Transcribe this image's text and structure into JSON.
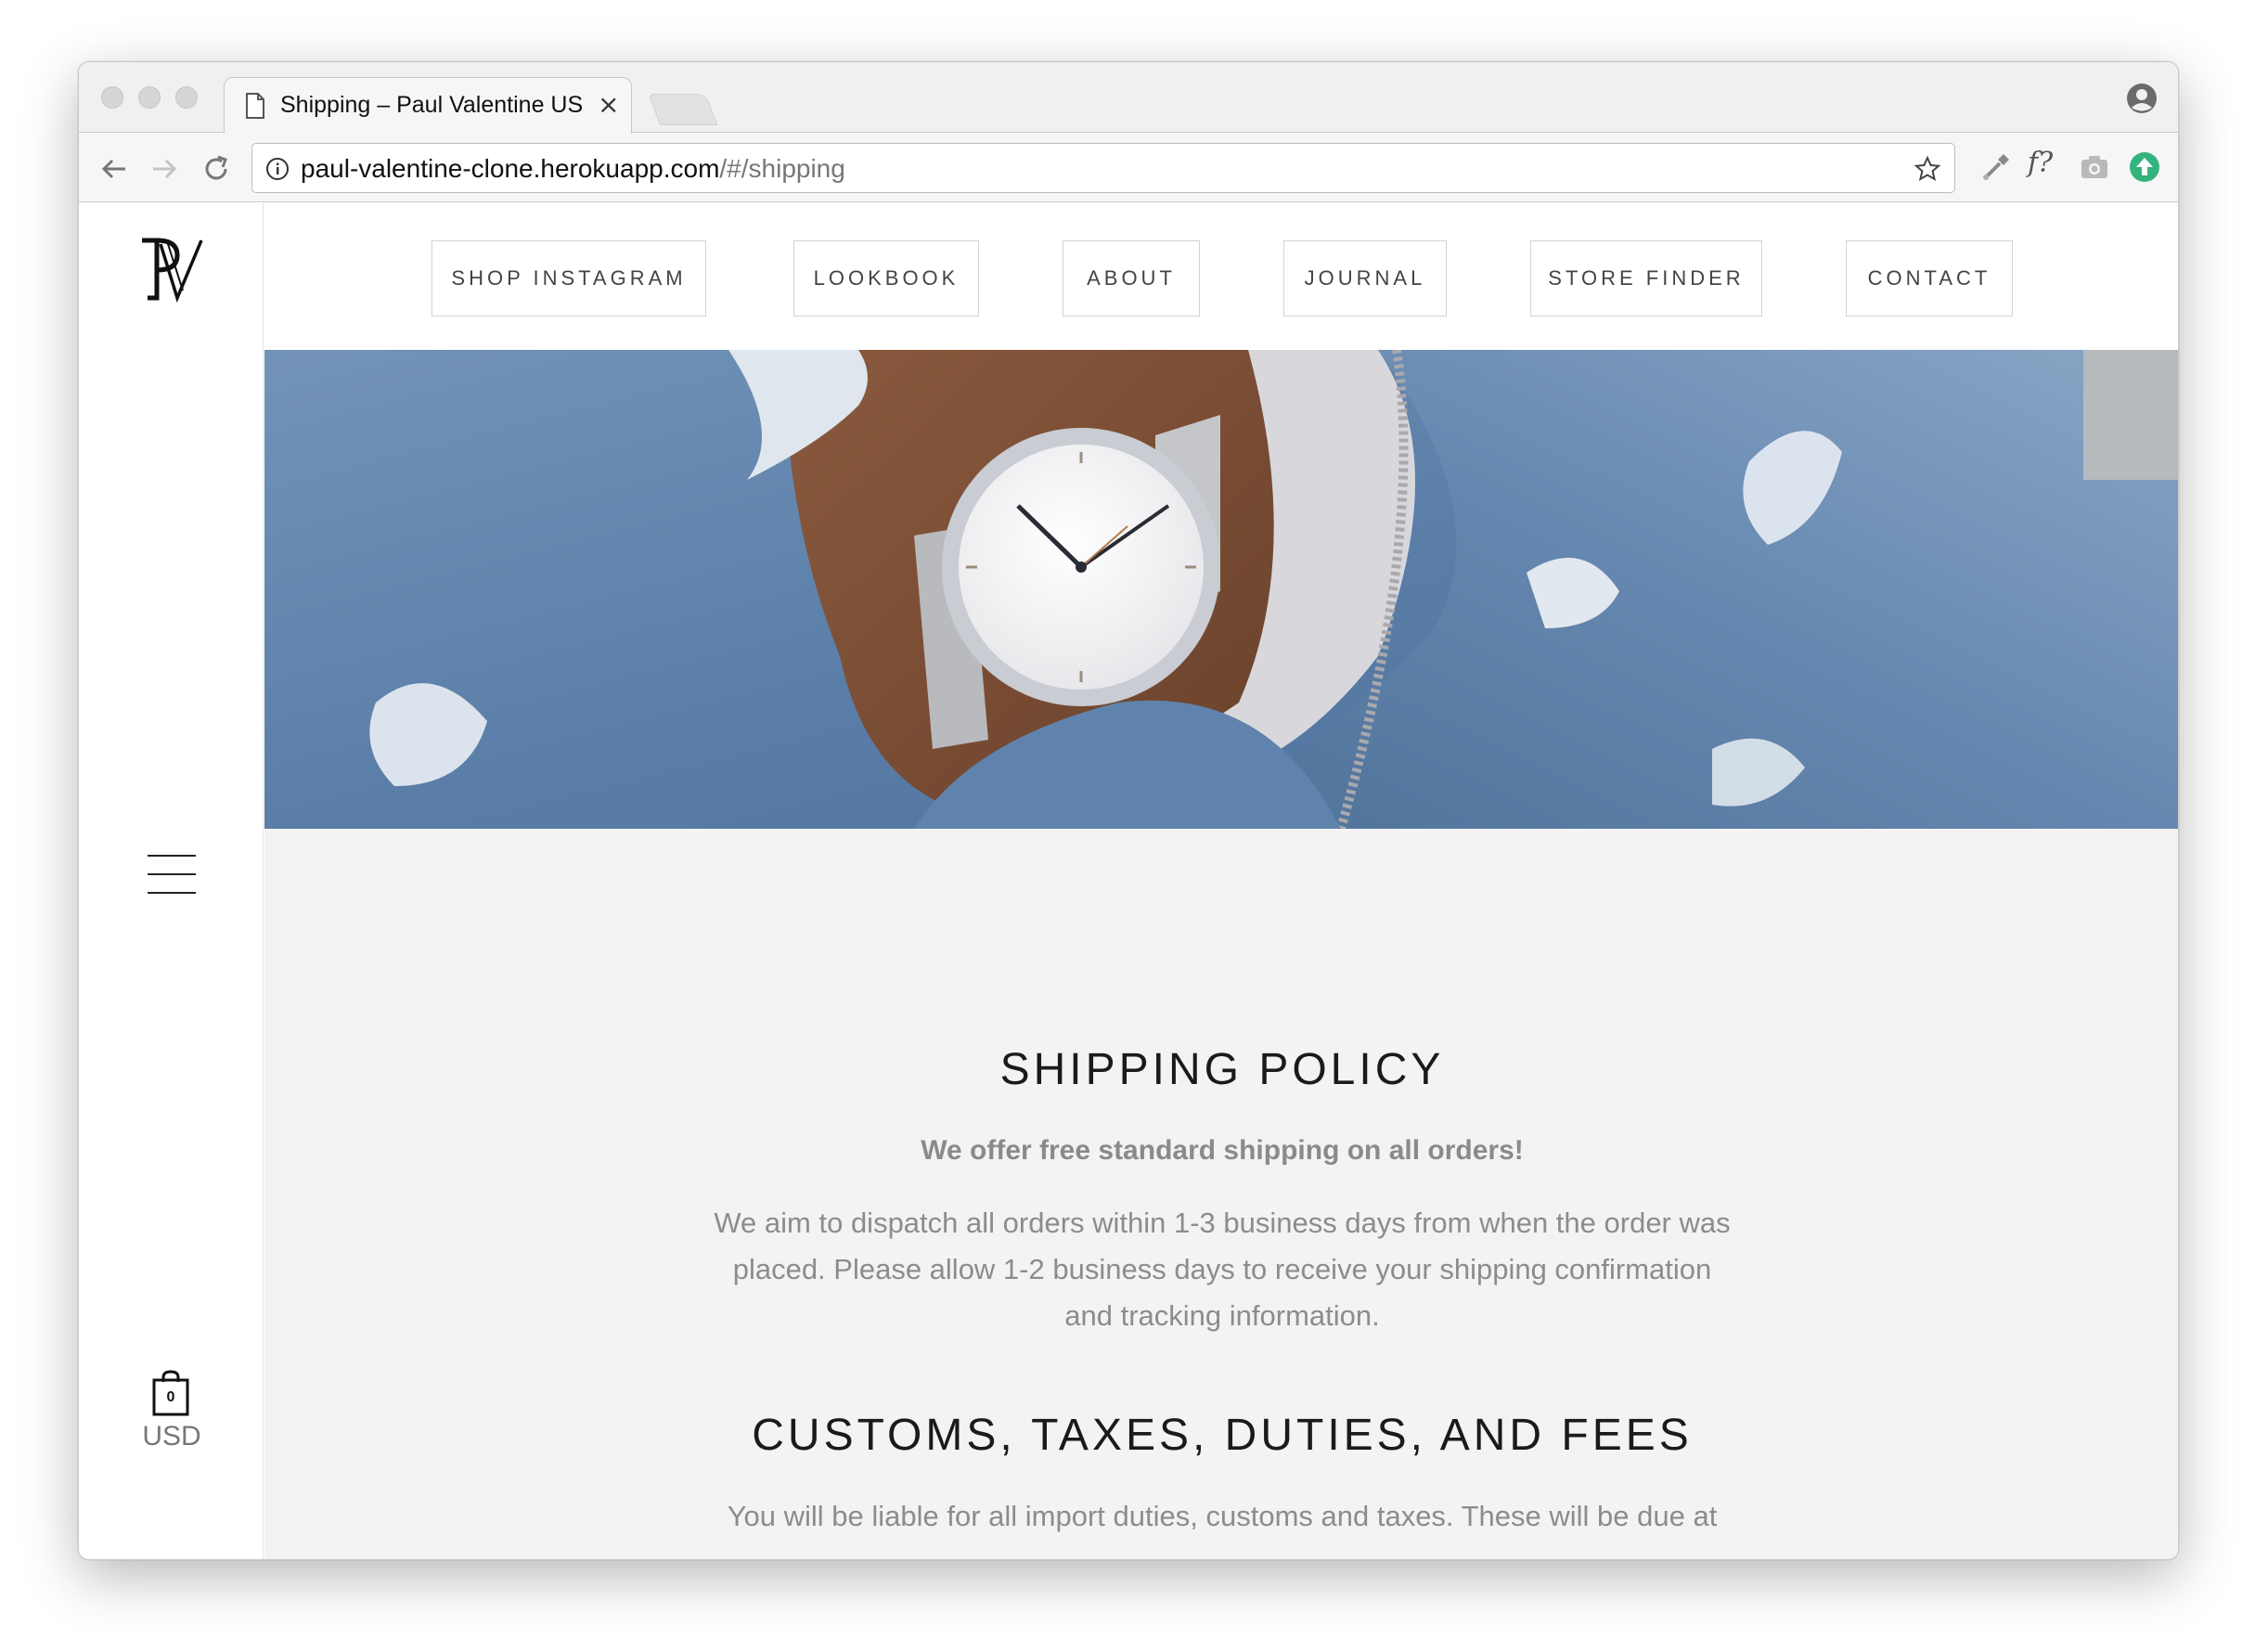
{
  "browser": {
    "tab_title": "Shipping – Paul Valentine US",
    "tab_close": "×",
    "url_host": "paul-valentine-clone.herokuapp.com",
    "url_path": "/#/shipping",
    "ext_font_label": "f?"
  },
  "sidebar": {
    "logo_icon": "pv-monogram-logo",
    "cart_count": "0",
    "currency": "USD"
  },
  "nav": {
    "items": [
      {
        "label": "SHOP INSTAGRAM"
      },
      {
        "label": "LOOKBOOK"
      },
      {
        "label": "ABOUT"
      },
      {
        "label": "JOURNAL"
      },
      {
        "label": "STORE FINDER"
      },
      {
        "label": "CONTACT"
      }
    ]
  },
  "content": {
    "heading": "SHIPPING POLICY",
    "lead": "We offer free standard shipping on all orders!",
    "paragraph": "We aim to dispatch all orders within 1-3 business days from when the order was placed. Please allow 1-2 business days to receive your shipping confirmation and tracking information.",
    "heading2": "CUSTOMS, TAXES, DUTIES, AND FEES",
    "paragraph2": "You will be liable for all import duties, customs and taxes. These will be due at"
  },
  "colors": {
    "denim": "#5f82aa",
    "content_bg": "#f3f3f5",
    "text_muted": "#8c8c8c",
    "extension_green": "#35b37e"
  }
}
